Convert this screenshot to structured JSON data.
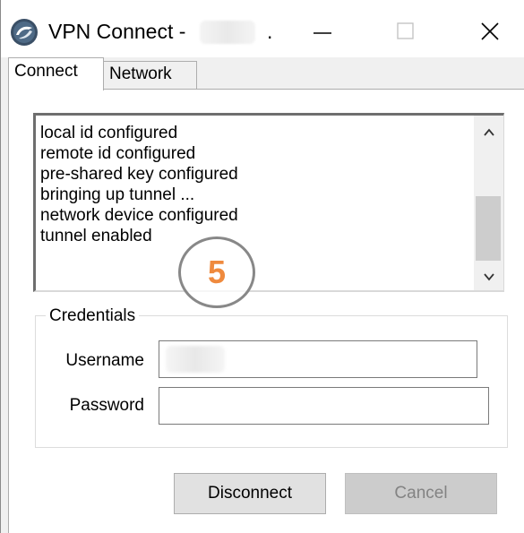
{
  "window": {
    "title": "VPN Connect -",
    "title_suffix": "."
  },
  "tabs": [
    {
      "label": "Connect",
      "active": true
    },
    {
      "label": "Network",
      "active": false
    }
  ],
  "log": {
    "lines": [
      "local id configured",
      "remote id configured",
      "pre-shared key configured",
      "bringing up tunnel ...",
      "network device configured",
      "tunnel enabled"
    ]
  },
  "annotation": {
    "number": "5",
    "color": "#ef8a3e"
  },
  "credentials": {
    "legend": "Credentials",
    "username_label": "Username",
    "username_value": "",
    "password_label": "Password",
    "password_value": ""
  },
  "buttons": {
    "disconnect": "Disconnect",
    "cancel": "Cancel"
  },
  "icons": {
    "app": "vpn-client-icon",
    "minimize": "minimize-icon",
    "maximize": "maximize-icon",
    "close": "close-icon",
    "scroll_up": "chevron-up-icon",
    "scroll_down": "chevron-down-icon"
  }
}
